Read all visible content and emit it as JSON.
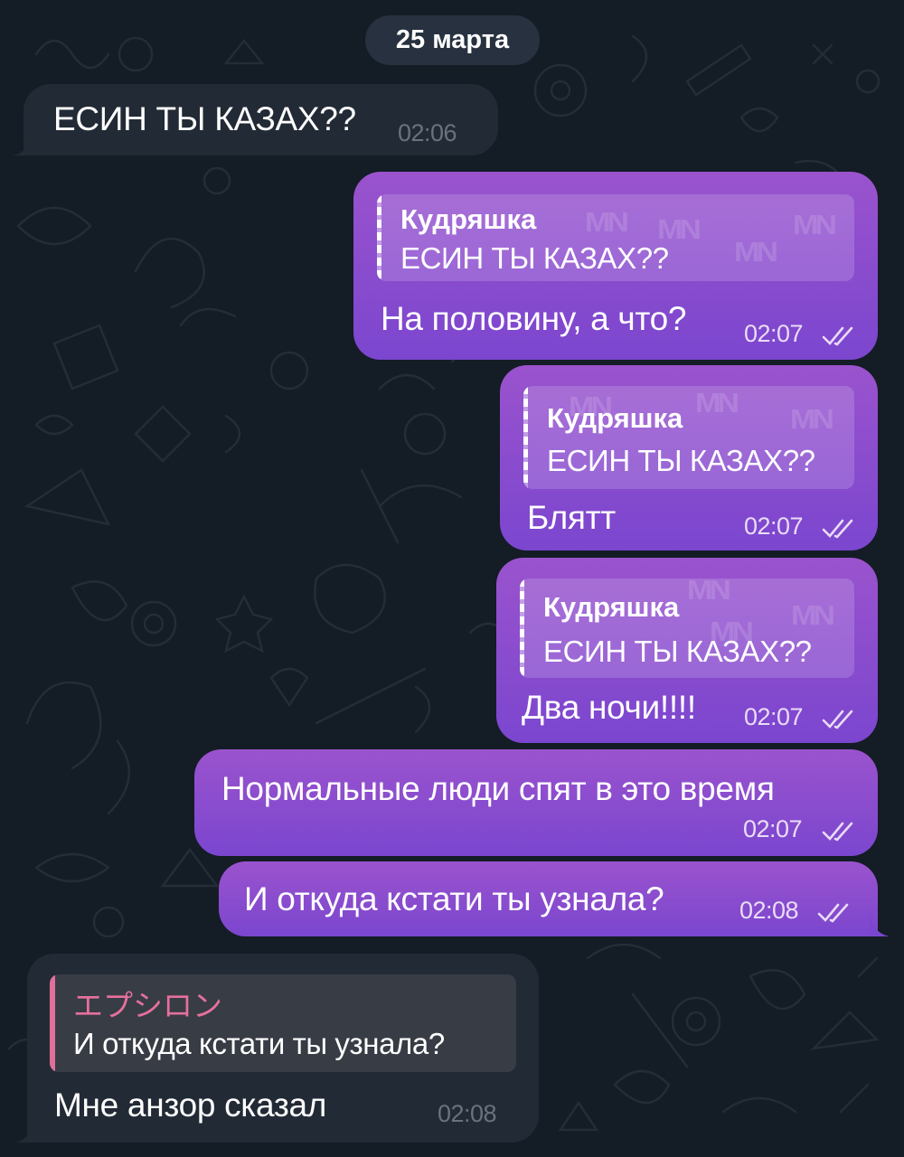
{
  "date_label": "25 марта",
  "messages": [
    {
      "text": "ЕСИН ТЫ КАЗАХ??",
      "time": "02:06"
    },
    {
      "reply_name": "Кудряшка",
      "reply_text": "ЕСИН ТЫ КАЗАХ??",
      "text": "На половину, а что?",
      "time": "02:07"
    },
    {
      "reply_name": "Кудряшка",
      "reply_text": "ЕСИН ТЫ КАЗАХ??",
      "text": "Блятт",
      "time": "02:07"
    },
    {
      "reply_name": "Кудряшка",
      "reply_text": "ЕСИН ТЫ КАЗАХ??",
      "text": "Два ночи!!!!",
      "time": "02:07"
    },
    {
      "text": "Нормальные люди спят в это время",
      "time": "02:07"
    },
    {
      "text": "И откуда кстати ты узнала?",
      "time": "02:08"
    },
    {
      "reply_name": "エプシロン",
      "reply_text": "И откуда кстати ты узнала?",
      "text": "Мне анзор сказал",
      "time": "02:08"
    }
  ],
  "watermark": "MN",
  "colors": {
    "background": "#141c25",
    "incoming_bubble": "#222a35",
    "outgoing_top": "#9a53cd",
    "outgoing_bottom": "#7b46cf",
    "incoming_reply_accent": "#e0709a"
  },
  "icons": {
    "read_status": "double-check-icon"
  }
}
